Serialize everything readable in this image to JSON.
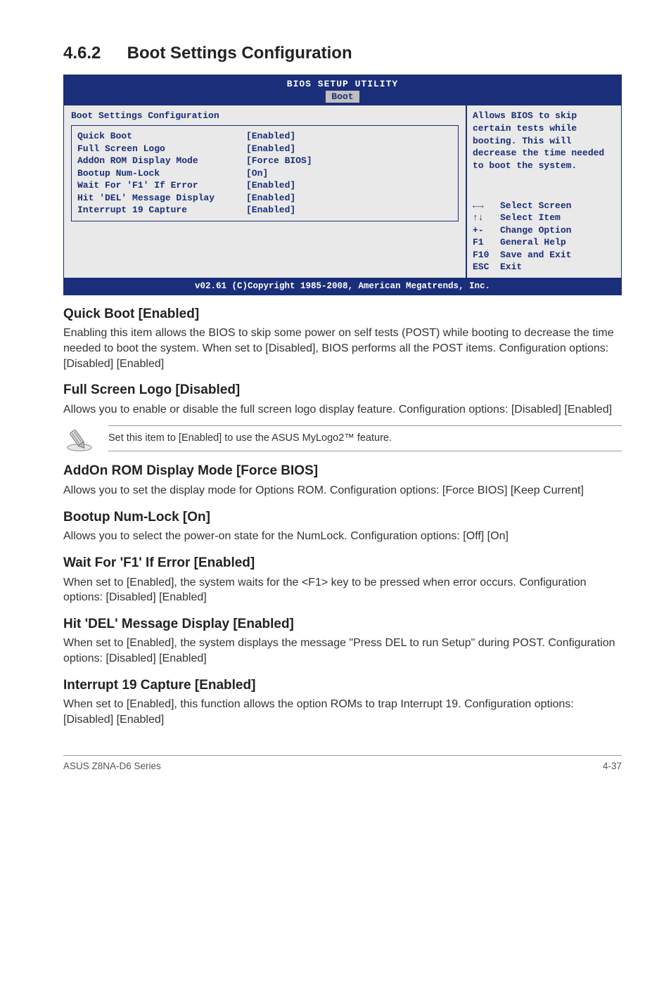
{
  "section": {
    "number": "4.6.2",
    "title": "Boot Settings Configuration"
  },
  "bios": {
    "header": "BIOS SETUP UTILITY",
    "tab": "Boot",
    "panel_title": "Boot Settings Configuration",
    "rows": [
      {
        "label": "Quick Boot",
        "value": "[Enabled]"
      },
      {
        "label": "Full Screen Logo",
        "value": "[Enabled]"
      },
      {
        "label": "AddOn ROM Display Mode",
        "value": "[Force BIOS]"
      },
      {
        "label": "Bootup Num-Lock",
        "value": "[On]"
      },
      {
        "label": "Wait For 'F1' If Error",
        "value": "[Enabled]"
      },
      {
        "label": "Hit 'DEL' Message Display",
        "value": "[Enabled]"
      },
      {
        "label": "Interrupt 19 Capture",
        "value": "[Enabled]"
      }
    ],
    "help_text": "Allows BIOS to skip certain tests while booting. This will decrease the time needed to boot the system.",
    "keys": [
      "←→   Select Screen",
      "↑↓   Select Item",
      "+-   Change Option",
      "F1   General Help",
      "F10  Save and Exit",
      "ESC  Exit"
    ],
    "footer": "v02.61 (C)Copyright 1985-2008, American Megatrends, Inc."
  },
  "options": [
    {
      "heading": "Quick Boot [Enabled]",
      "desc": "Enabling this item allows the BIOS to skip some power on self tests (POST) while booting to decrease the time needed to boot the system. When set to [Disabled], BIOS performs all the POST items. Configuration options: [Disabled] [Enabled]"
    },
    {
      "heading": "Full Screen Logo [Disabled]",
      "desc": "Allows you to enable or disable the full screen logo display feature. Configuration options: [Disabled] [Enabled]"
    }
  ],
  "note": "Set this item to [Enabled] to use the ASUS MyLogo2™ feature.",
  "options2": [
    {
      "heading": "AddOn ROM Display Mode [Force BIOS]",
      "desc": "Allows you to set the display mode for Options ROM. Configuration options: [Force BIOS] [Keep Current]"
    },
    {
      "heading": "Bootup Num-Lock [On]",
      "desc": "Allows you to select the power-on state for the NumLock. Configuration options: [Off] [On]"
    },
    {
      "heading": "Wait For 'F1' If Error [Enabled]",
      "desc": "When set to [Enabled], the system waits for the <F1> key to be pressed when error occurs. Configuration options: [Disabled] [Enabled]"
    },
    {
      "heading": "Hit 'DEL' Message Display [Enabled]",
      "desc": "When set to [Enabled], the system displays the message \"Press DEL to run Setup\" during POST. Configuration options: [Disabled] [Enabled]"
    },
    {
      "heading": "Interrupt 19 Capture [Enabled]",
      "desc": "When set to [Enabled], this function allows the option ROMs to trap Interrupt 19. Configuration options: [Disabled] [Enabled]"
    }
  ],
  "footer": {
    "left": "ASUS Z8NA-D6 Series",
    "right": "4-37"
  }
}
